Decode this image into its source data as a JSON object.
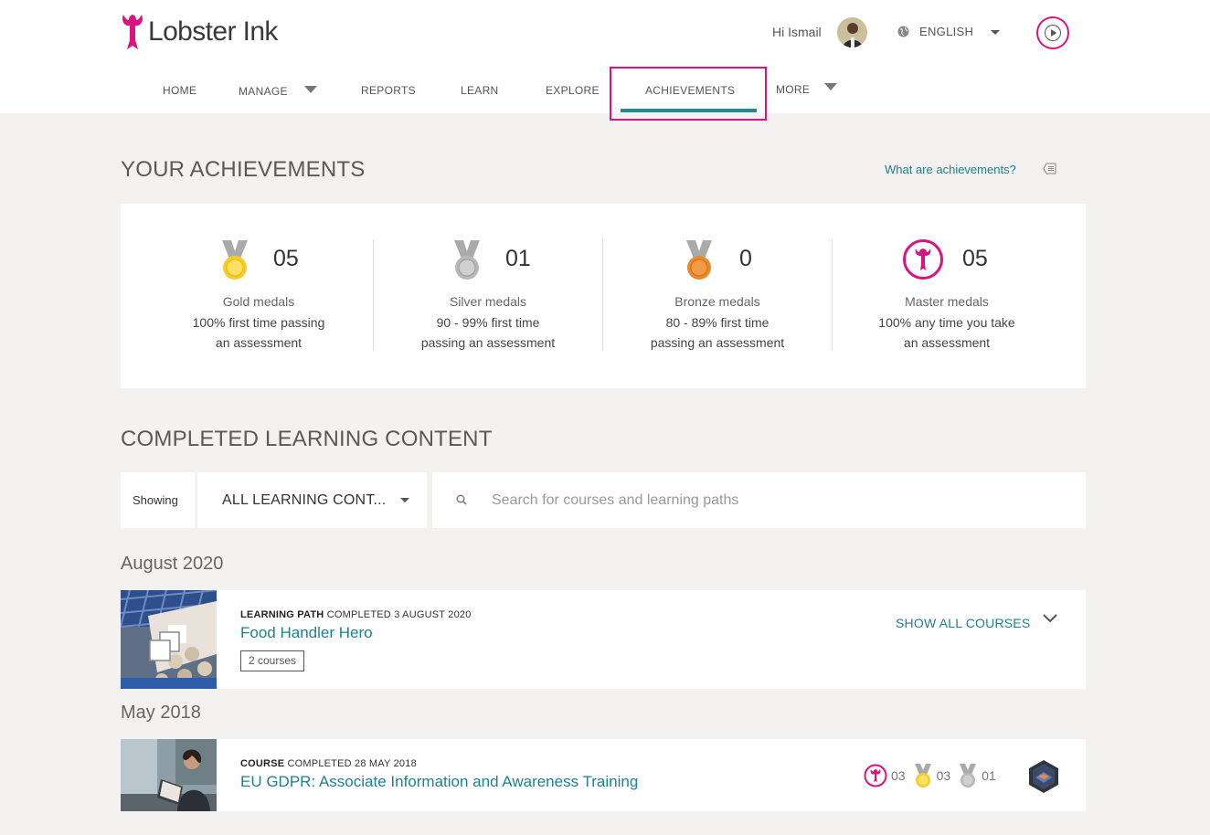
{
  "header": {
    "brand": "Lobster Ink",
    "greeting": "Hi Ismail",
    "language": "ENGLISH"
  },
  "nav": {
    "items": [
      {
        "label": "HOME"
      },
      {
        "label": "MANAGE"
      },
      {
        "label": "REPORTS"
      },
      {
        "label": "LEARN"
      },
      {
        "label": "EXPLORE"
      },
      {
        "label": "ACHIEVEMENTS"
      },
      {
        "label": "MORE"
      }
    ],
    "active": "ACHIEVEMENTS"
  },
  "achievements": {
    "title": "YOUR ACHIEVEMENTS",
    "help_link": "What are achievements?",
    "medals": [
      {
        "count": "05",
        "label": "Gold medals",
        "desc1": "100% first time passing",
        "desc2": "an assessment",
        "color": "#f5cd2b"
      },
      {
        "count": "01",
        "label": "Silver medals",
        "desc1": "90 - 99% first time",
        "desc2": "passing an assessment",
        "color": "#b8b8b8"
      },
      {
        "count": "0",
        "label": "Bronze medals",
        "desc1": "80 - 89% first time",
        "desc2": "passing an assessment",
        "color": "#e98a2e"
      },
      {
        "count": "05",
        "label": "Master medals",
        "desc1": "100% any time you take",
        "desc2": "an assessment",
        "color": "#d8147f"
      }
    ]
  },
  "completed": {
    "title": "COMPLETED LEARNING CONTENT",
    "filter_label": "Showing",
    "filter_value": "ALL LEARNING CONT...",
    "search_placeholder": "Search for courses and learning paths",
    "groups": [
      {
        "month": "August 2020",
        "item": {
          "type": "LEARNING PATH",
          "completed": "COMPLETED 3 AUGUST 2020",
          "title": "Food Handler Hero",
          "tag": "2 courses",
          "action": "SHOW ALL COURSES"
        }
      },
      {
        "month": "May 2018",
        "item": {
          "type": "COURSE",
          "completed": "COMPLETED 28 MAY 2018",
          "title": "EU GDPR: Associate Information and Awareness Training",
          "master_count": "03",
          "gold_count": "03",
          "silver_count": "01"
        }
      }
    ]
  },
  "colors": {
    "brand": "#d8147f",
    "accent": "#1e8a98",
    "gold": "#f5cd2b",
    "silver": "#b8b8b8",
    "bronze": "#e98a2e"
  }
}
